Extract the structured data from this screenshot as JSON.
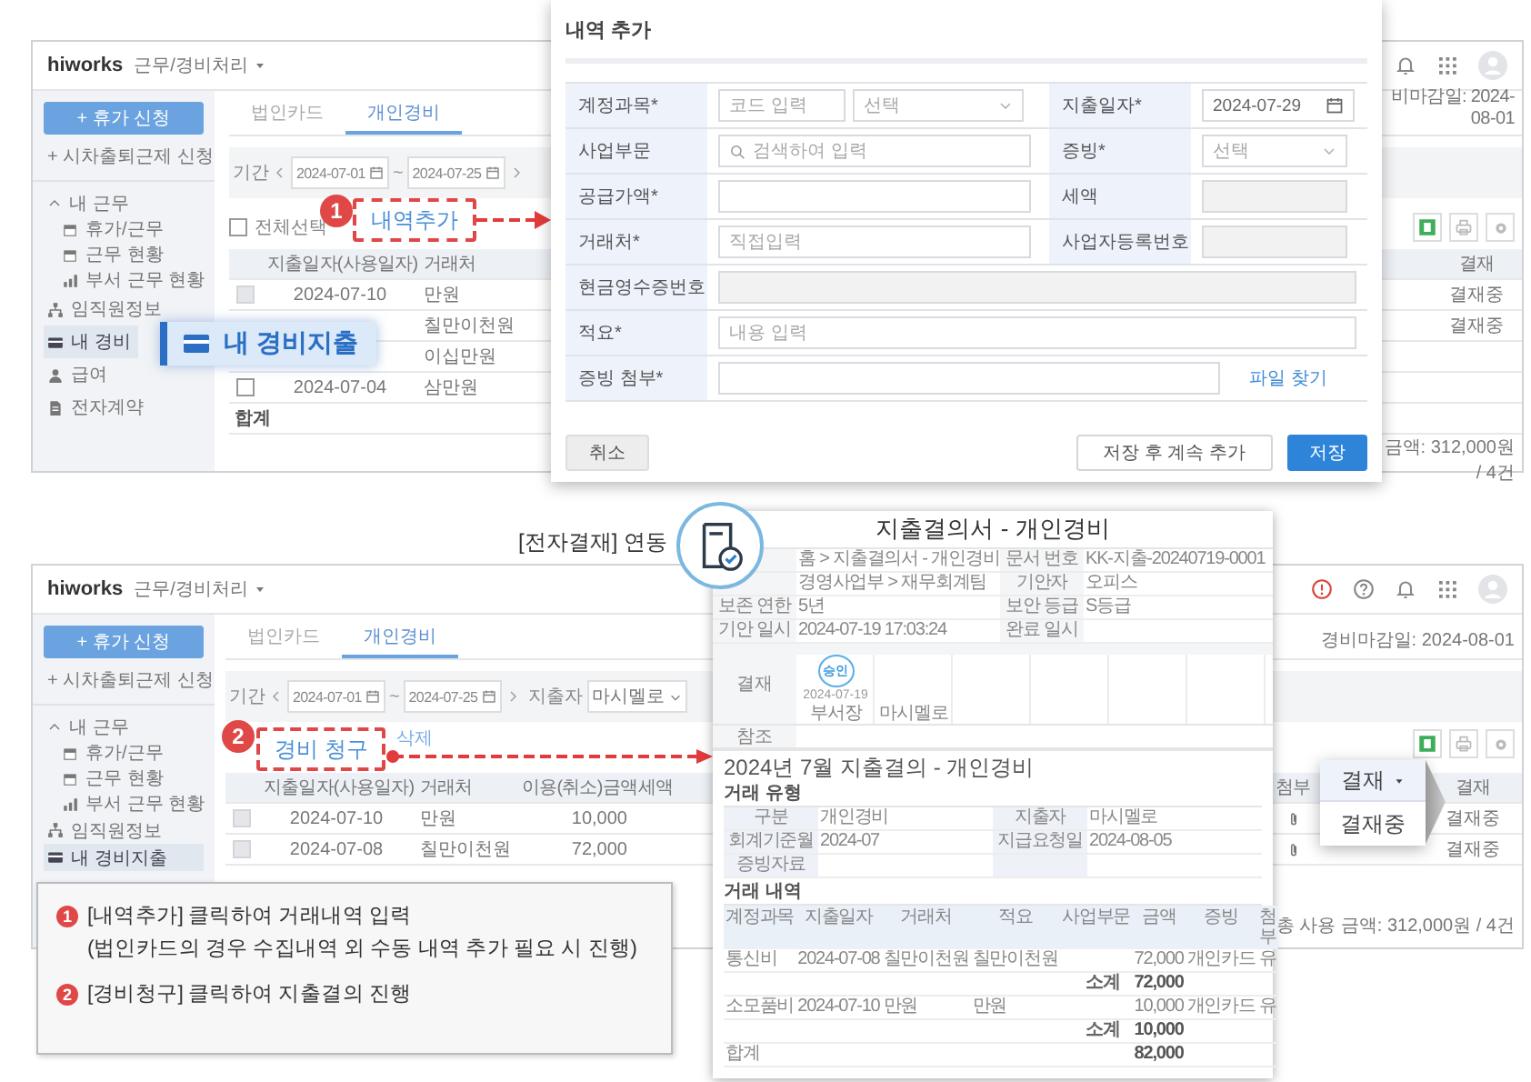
{
  "step1_screen": {
    "logo": "hiworks",
    "module": "근무/경비처리",
    "sidebar": {
      "new_button": "+ 휴가 신청",
      "flex_link": "+ 시차출퇴근제 신청",
      "items": [
        {
          "label": "내 근무",
          "kind": "group",
          "expanded": true,
          "selected": false,
          "children": [
            {
              "label": "휴가/근무",
              "kind": "calendar",
              "selected": false
            },
            {
              "label": "근무 현황",
              "kind": "calendar",
              "selected": false
            },
            {
              "label": "부서 근무 현황",
              "kind": "chart",
              "selected": false
            }
          ]
        },
        {
          "label": "임직원정보",
          "kind": "org",
          "selected": false
        },
        {
          "label": "내 경비",
          "kind": "card",
          "selected": true
        },
        {
          "label": "급여",
          "kind": "people",
          "selected": false
        },
        {
          "label": "전자계약",
          "kind": "contract",
          "selected": false
        }
      ]
    },
    "tabs": [
      {
        "label": "법인카드",
        "selected": false
      },
      {
        "label": "개인경비",
        "selected": true
      }
    ],
    "deadline": "비마감일: 2024-08-01",
    "period": {
      "label": "기간",
      "from": "2024-07-01",
      "separator": "~",
      "to": "2024-07-25"
    },
    "select_all": {
      "label": "전체선택",
      "checked": false
    },
    "step_marker": {
      "number": "1",
      "label": "내역추가"
    },
    "table": {
      "columns": [
        "지출일자(사용일자)",
        "거래처"
      ],
      "right_columns": [
        "결재"
      ],
      "rows": [
        {
          "date": "2024-07-10",
          "vendor": "만원",
          "disabled": true,
          "status": "결재중"
        },
        {
          "vendor": "칠만이천원",
          "status": "결재중"
        },
        {
          "vendor": "이십만원"
        },
        {
          "date": "2024-07-04",
          "vendor": "삼만원",
          "disabled": false
        }
      ],
      "total_label": "합계"
    },
    "summary": "금액: 312,000원 / 4건",
    "menu_callout": "내 경비지출"
  },
  "dialog": {
    "title": "내역 추가",
    "rows": [
      {
        "cells": [
          {
            "label": "계정과목*",
            "fields": [
              {
                "kind": "text",
                "placeholder": "코드 입력"
              },
              {
                "kind": "select",
                "placeholder": "선택"
              }
            ]
          },
          {
            "label": "지출일자*",
            "fields": [
              {
                "kind": "date",
                "value": "2024-07-29"
              }
            ]
          }
        ]
      },
      {
        "cells": [
          {
            "label": "사업부문",
            "fields": [
              {
                "kind": "search",
                "placeholder": "검색하여 입력"
              }
            ]
          },
          {
            "label": "증빙*",
            "fields": [
              {
                "kind": "select",
                "placeholder": "선택"
              }
            ]
          }
        ]
      },
      {
        "cells": [
          {
            "label": "공급가액*",
            "fields": [
              {
                "kind": "text"
              }
            ]
          },
          {
            "label": "세액",
            "fields": [
              {
                "kind": "readonly"
              }
            ]
          }
        ]
      },
      {
        "cells": [
          {
            "label": "거래처*",
            "fields": [
              {
                "kind": "text",
                "placeholder": "직접입력"
              }
            ]
          },
          {
            "label": "사업자등록번호",
            "fields": [
              {
                "kind": "readonly"
              }
            ]
          }
        ]
      },
      {
        "cells": [
          {
            "label": "현금영수증번호",
            "fields": [
              {
                "kind": "readonly"
              }
            ]
          }
        ]
      },
      {
        "cells": [
          {
            "label": "적요*",
            "fields": [
              {
                "kind": "text",
                "placeholder": "내용 입력"
              }
            ]
          }
        ]
      },
      {
        "cells": [
          {
            "label": "증빙 첨부*",
            "fields": [
              {
                "kind": "file",
                "action": "파일 찾기"
              }
            ]
          }
        ]
      }
    ],
    "buttons": [
      {
        "label": "취소",
        "kind": "secondary"
      },
      {
        "label": "저장 후 계속 추가",
        "kind": "outline"
      },
      {
        "label": "저장",
        "kind": "primary"
      }
    ]
  },
  "caption": "[전자결재] 연동",
  "step2_screen": {
    "logo": "hiworks",
    "module": "근무/경비처리",
    "sidebar": {
      "new_button": "+ 휴가 신청",
      "flex_link": "+ 시차출퇴근제 신청",
      "items": [
        {
          "label": "내 근무",
          "kind": "group",
          "expanded": true,
          "selected": false,
          "children": [
            {
              "label": "휴가/근무",
              "kind": "calendar",
              "selected": false
            },
            {
              "label": "근무 현황",
              "kind": "calendar",
              "selected": false
            },
            {
              "label": "부서 근무 현황",
              "kind": "chart",
              "selected": false
            }
          ]
        },
        {
          "label": "임직원정보",
          "kind": "org",
          "selected": false
        },
        {
          "label": "내 경비지출",
          "kind": "card",
          "selected": true
        }
      ]
    },
    "tabs": [
      {
        "label": "법인카드",
        "selected": false
      },
      {
        "label": "개인경비",
        "selected": true
      }
    ],
    "deadline": "경비마감일: 2024-08-01",
    "period": {
      "label": "기간",
      "from": "2024-07-01",
      "separator": "~",
      "to": "2024-07-25"
    },
    "spender": {
      "label": "지출자",
      "value": "마시멜로"
    },
    "step_marker": {
      "number": "2",
      "label": "경비 청구"
    },
    "toolbar_link": "삭제",
    "table": {
      "columns": [
        "지출일자(사용일자)",
        "거래처",
        "이용(취소)금액",
        "세액"
      ],
      "right_columns": [
        "첨부",
        "결재"
      ],
      "rows": [
        {
          "date": "2024-07-10",
          "vendor": "만원",
          "amount": "10,000",
          "disabled": true,
          "attached": true,
          "status": "결재중"
        },
        {
          "date": "2024-07-08",
          "vendor": "칠만이천원",
          "amount": "72,000",
          "disabled": true,
          "attached": true,
          "status": "결재중"
        }
      ]
    },
    "summary": "총 사용 금액: 312,000원 / 4건",
    "status_popup": {
      "header": "결재",
      "item": "결재중"
    }
  },
  "approval_doc": {
    "title": "지출결의서 - 개인경비",
    "info": [
      {
        "value": "홈 > 지출결의서 - 개인경비",
        "label2": "문서 번호",
        "value2": "KK-지출-20240719-0001"
      },
      {
        "value": "경영사업부 > 재무회계팀",
        "label2": "기안자",
        "value2": "오피스"
      },
      {
        "label": "보존 연한",
        "value": "5년",
        "label2": "보안 등급",
        "value2": "S등급"
      },
      {
        "label": "기안 일시",
        "value": "2024-07-19 17:03:24",
        "label2": "완료 일시"
      }
    ],
    "approval": {
      "label": "결재",
      "stamp": "승인",
      "date": "2024-07-19",
      "roles": [
        "부서장",
        "마시멜로"
      ]
    },
    "reference_label": "참조",
    "heading": "2024년 7월 지출결의 - 개인경비",
    "type_section": {
      "title": "거래 유형",
      "rows": [
        {
          "label": "구분",
          "value": "개인경비",
          "label2": "지출자",
          "value2": "마시멜로"
        },
        {
          "label": "회계기준월",
          "value": "2024-07",
          "label2": "지급요청일",
          "value2": "2024-08-05"
        },
        {
          "label": "증빙자료"
        }
      ]
    },
    "detail_section": {
      "title": "거래 내역",
      "columns": [
        "계정과목",
        "지출일자",
        "거래처",
        "적요",
        "사업부문",
        "금액",
        "증빙",
        "첨부"
      ],
      "rows": [
        {
          "kind": "item",
          "account": "통신비",
          "date": "2024-07-08",
          "vendor": "칠만이천원",
          "memo": "칠만이천원",
          "amount": "72,000",
          "proof": "개인카드",
          "attach": "유"
        },
        {
          "kind": "subtotal",
          "label": "소계",
          "amount": "72,000"
        },
        {
          "kind": "item",
          "account": "소모품비",
          "date": "2024-07-10",
          "vendor": "만원",
          "memo": "만원",
          "amount": "10,000",
          "proof": "개인카드",
          "attach": "유"
        },
        {
          "kind": "subtotal",
          "label": "소계",
          "amount": "10,000"
        },
        {
          "kind": "total",
          "title": "합계",
          "amount": "82,000"
        }
      ]
    }
  },
  "legend": [
    {
      "number": "1",
      "lines": [
        "[내역추가] 클릭하여 거래내역 입력",
        "(법인카드의 경우 수집내역 외 수동 내역 추가 필요 시 진행)"
      ]
    },
    {
      "number": "2",
      "lines": [
        "[경비청구] 클릭하여 지출결의 진행"
      ]
    }
  ]
}
